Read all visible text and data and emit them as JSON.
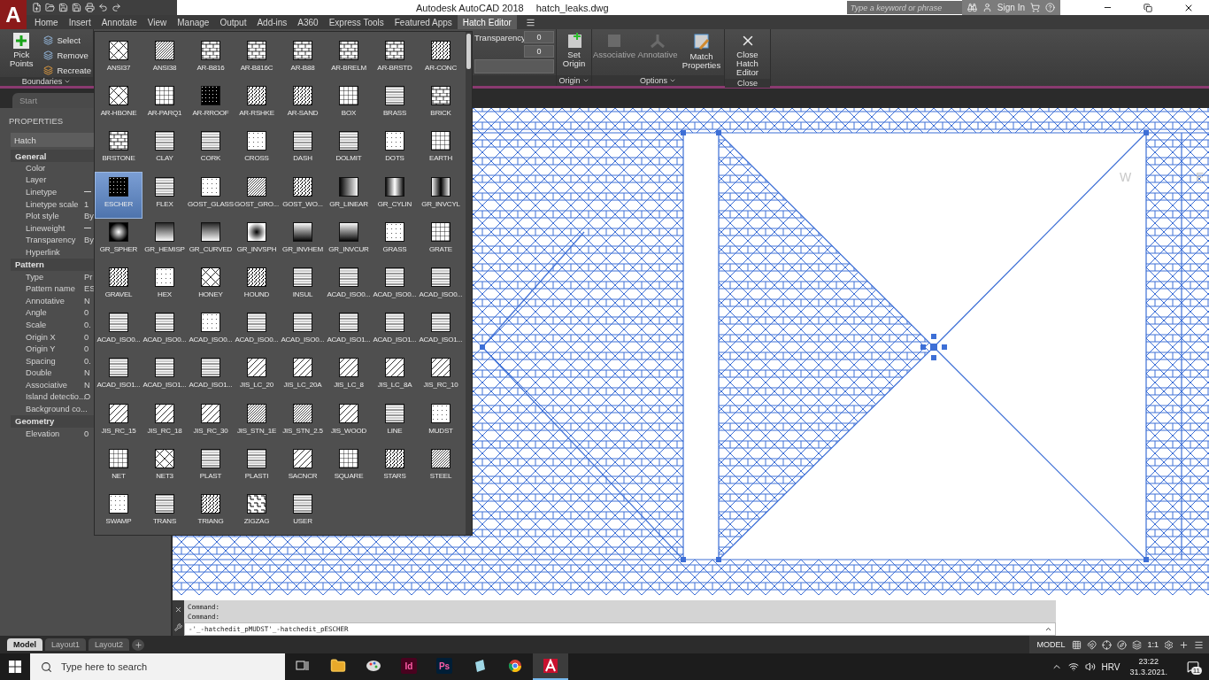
{
  "app_logo": "A",
  "title_bar": {
    "app_name": "Autodesk AutoCAD 2018",
    "file_name": "hatch_leaks.dwg",
    "search": {
      "placeholder": "Type a keyword or phrase"
    },
    "sign_in": "Sign In"
  },
  "ribbon_tabs": [
    {
      "label": "Home",
      "selected": false
    },
    {
      "label": "Insert",
      "selected": false
    },
    {
      "label": "Annotate",
      "selected": false
    },
    {
      "label": "View",
      "selected": false
    },
    {
      "label": "Manage",
      "selected": false
    },
    {
      "label": "Output",
      "selected": false
    },
    {
      "label": "Add-ins",
      "selected": false
    },
    {
      "label": "A360",
      "selected": false
    },
    {
      "label": "Express Tools",
      "selected": false
    },
    {
      "label": "Featured Apps",
      "selected": false
    },
    {
      "label": "Hatch Editor",
      "selected": true
    }
  ],
  "ribbon": {
    "boundaries": {
      "pick_points": "Pick Points",
      "select": "Select",
      "remove": "Remove",
      "recreate": "Recreate",
      "footer": "Boundaries"
    },
    "properties": {
      "transparency_label": "Transparency",
      "transparency_value": "0",
      "second_value": "0"
    },
    "origin": {
      "set_origin": "Set Origin",
      "footer": "Origin"
    },
    "options": {
      "buttons": [
        {
          "label": "Associative",
          "disabled": true
        },
        {
          "label": "Annotative",
          "disabled": true
        }
      ],
      "match_properties": "Match Properties",
      "footer": "Options"
    },
    "close": {
      "button": "Close Hatch Editor",
      "footer": "Close"
    }
  },
  "file_tabs": [
    {
      "label": "Start"
    }
  ],
  "properties_palette": {
    "title": "PROPERTIES",
    "selector": "Hatch",
    "sections": [
      {
        "title": "General",
        "rows": [
          {
            "label": "Color"
          },
          {
            "label": "Layer"
          },
          {
            "label": "Linetype",
            "line_sample": true
          },
          {
            "label": "Linetype scale",
            "value": "1"
          },
          {
            "label": "Plot style",
            "value": "By"
          },
          {
            "label": "Lineweight",
            "line_sample": true
          },
          {
            "label": "Transparency",
            "value": "By"
          },
          {
            "label": "Hyperlink"
          }
        ]
      },
      {
        "title": "Pattern",
        "rows": [
          {
            "label": "Type",
            "value": "Pr"
          },
          {
            "label": "Pattern name",
            "value": "ES"
          },
          {
            "label": "Annotative",
            "value": "N"
          },
          {
            "label": "Angle",
            "value": "0"
          },
          {
            "label": "Scale",
            "value": "0."
          },
          {
            "label": "Origin X",
            "value": "0"
          },
          {
            "label": "Origin Y",
            "value": "0"
          },
          {
            "label": "Spacing",
            "value": "0."
          },
          {
            "label": "Double",
            "value": "N"
          },
          {
            "label": "Associative",
            "value": "N"
          },
          {
            "label": "Island detectio...",
            "value": "O"
          },
          {
            "label": "Background co..."
          }
        ]
      },
      {
        "title": "Geometry",
        "rows": [
          {
            "label": "Elevation",
            "value": "0"
          }
        ]
      }
    ]
  },
  "pattern_gallery": {
    "items": [
      {
        "name": "ANSI37",
        "kind": "cross",
        "selected": false
      },
      {
        "name": "ANSI38",
        "kind": "diag-dense",
        "selected": false
      },
      {
        "name": "AR-B816",
        "kind": "brick",
        "selected": false
      },
      {
        "name": "AR-B816C",
        "kind": "brick",
        "selected": false
      },
      {
        "name": "AR-B88",
        "kind": "brick",
        "selected": false
      },
      {
        "name": "AR-BRELM",
        "kind": "brick",
        "selected": false
      },
      {
        "name": "AR-BRSTD",
        "kind": "brick",
        "selected": false
      },
      {
        "name": "AR-CONC",
        "kind": "noise",
        "selected": false
      },
      {
        "name": "AR-HBONE",
        "kind": "cross",
        "selected": false
      },
      {
        "name": "AR-PARQ1",
        "kind": "grid",
        "selected": false
      },
      {
        "name": "AR-RROOF",
        "kind": "dark",
        "selected": false
      },
      {
        "name": "AR-RSHKE",
        "kind": "noise",
        "selected": false
      },
      {
        "name": "AR-SAND",
        "kind": "noise",
        "selected": false
      },
      {
        "name": "BOX",
        "kind": "grid",
        "selected": false
      },
      {
        "name": "BRASS",
        "kind": "lines",
        "selected": false
      },
      {
        "name": "BRICK",
        "kind": "brick",
        "selected": false
      },
      {
        "name": "BRSTONE",
        "kind": "brick",
        "selected": false
      },
      {
        "name": "CLAY",
        "kind": "lines",
        "selected": false
      },
      {
        "name": "CORK",
        "kind": "lines",
        "selected": false
      },
      {
        "name": "CROSS",
        "kind": "dots",
        "selected": false
      },
      {
        "name": "DASH",
        "kind": "lines",
        "selected": false
      },
      {
        "name": "DOLMIT",
        "kind": "lines",
        "selected": false
      },
      {
        "name": "DOTS",
        "kind": "dots",
        "selected": false
      },
      {
        "name": "EARTH",
        "kind": "grid",
        "selected": false
      },
      {
        "name": "ESCHER",
        "kind": "dark",
        "selected": true
      },
      {
        "name": "FLEX",
        "kind": "lines",
        "selected": false
      },
      {
        "name": "GOST_GLASS",
        "kind": "dots",
        "selected": false
      },
      {
        "name": "GOST_GRO...",
        "kind": "diag-dense",
        "selected": false
      },
      {
        "name": "GOST_WO...",
        "kind": "noise",
        "selected": false
      },
      {
        "name": "GR_LINEAR",
        "kind": "grad-linear",
        "selected": false
      },
      {
        "name": "GR_CYLIN",
        "kind": "grad-cyl",
        "selected": false
      },
      {
        "name": "GR_INVCYL",
        "kind": "grad-invcyl",
        "selected": false
      },
      {
        "name": "GR_SPHER",
        "kind": "grad-sphere",
        "selected": false
      },
      {
        "name": "GR_HEMISP",
        "kind": "grad-hemi",
        "selected": false
      },
      {
        "name": "GR_CURVED",
        "kind": "grad-hemi",
        "selected": false
      },
      {
        "name": "GR_INVSPH",
        "kind": "grad-invsph",
        "selected": false
      },
      {
        "name": "GR_INVHEM",
        "kind": "grad-invhem",
        "selected": false
      },
      {
        "name": "GR_INVCUR",
        "kind": "grad-invhem",
        "selected": false
      },
      {
        "name": "GRASS",
        "kind": "dots",
        "selected": false
      },
      {
        "name": "GRATE",
        "kind": "grid",
        "selected": false
      },
      {
        "name": "GRAVEL",
        "kind": "noise",
        "selected": false
      },
      {
        "name": "HEX",
        "kind": "dots",
        "selected": false
      },
      {
        "name": "HONEY",
        "kind": "cross",
        "selected": false
      },
      {
        "name": "HOUND",
        "kind": "noise",
        "selected": false
      },
      {
        "name": "INSUL",
        "kind": "lines",
        "selected": false
      },
      {
        "name": "ACAD_ISO0...",
        "kind": "lines",
        "selected": false
      },
      {
        "name": "ACAD_ISO0...",
        "kind": "lines",
        "selected": false
      },
      {
        "name": "ACAD_ISO0...",
        "kind": "lines",
        "selected": false
      },
      {
        "name": "ACAD_ISO0...",
        "kind": "lines",
        "selected": false
      },
      {
        "name": "ACAD_ISO0...",
        "kind": "lines",
        "selected": false
      },
      {
        "name": "ACAD_ISO0...",
        "kind": "dots",
        "selected": false
      },
      {
        "name": "ACAD_ISO0...",
        "kind": "lines",
        "selected": false
      },
      {
        "name": "ACAD_ISO0...",
        "kind": "lines",
        "selected": false
      },
      {
        "name": "ACAD_ISO1...",
        "kind": "lines",
        "selected": false
      },
      {
        "name": "ACAD_ISO1...",
        "kind": "lines",
        "selected": false
      },
      {
        "name": "ACAD_ISO1...",
        "kind": "lines",
        "selected": false
      },
      {
        "name": "ACAD_ISO1...",
        "kind": "lines",
        "selected": false
      },
      {
        "name": "ACAD_ISO1...",
        "kind": "lines",
        "selected": false
      },
      {
        "name": "ACAD_ISO1...",
        "kind": "lines",
        "selected": false
      },
      {
        "name": "JIS_LC_20",
        "kind": "diag",
        "selected": false
      },
      {
        "name": "JIS_LC_20A",
        "kind": "diag",
        "selected": false
      },
      {
        "name": "JIS_LC_8",
        "kind": "diag",
        "selected": false
      },
      {
        "name": "JIS_LC_8A",
        "kind": "diag",
        "selected": false
      },
      {
        "name": "JIS_RC_10",
        "kind": "diag",
        "selected": false
      },
      {
        "name": "JIS_RC_15",
        "kind": "diag",
        "selected": false
      },
      {
        "name": "JIS_RC_18",
        "kind": "diag",
        "selected": false
      },
      {
        "name": "JIS_RC_30",
        "kind": "diag",
        "selected": false
      },
      {
        "name": "JIS_STN_1E",
        "kind": "diag-dense",
        "selected": false
      },
      {
        "name": "JIS_STN_2.5",
        "kind": "diag-dense",
        "selected": false
      },
      {
        "name": "JIS_WOOD",
        "kind": "diag",
        "selected": false
      },
      {
        "name": "LINE",
        "kind": "lines",
        "selected": false
      },
      {
        "name": "MUDST",
        "kind": "dots",
        "selected": false
      },
      {
        "name": "NET",
        "kind": "grid",
        "selected": false
      },
      {
        "name": "NET3",
        "kind": "cross",
        "selected": false
      },
      {
        "name": "PLAST",
        "kind": "lines",
        "selected": false
      },
      {
        "name": "PLASTI",
        "kind": "lines",
        "selected": false
      },
      {
        "name": "SACNCR",
        "kind": "diag",
        "selected": false
      },
      {
        "name": "SQUARE",
        "kind": "grid",
        "selected": false
      },
      {
        "name": "STARS",
        "kind": "noise",
        "selected": false
      },
      {
        "name": "STEEL",
        "kind": "diag-dense",
        "selected": false
      },
      {
        "name": "SWAMP",
        "kind": "dots",
        "selected": false
      },
      {
        "name": "TRANS",
        "kind": "lines",
        "selected": false
      },
      {
        "name": "TRIANG",
        "kind": "noise",
        "selected": false
      },
      {
        "name": "ZIGZAG",
        "kind": "zigzag",
        "selected": false
      },
      {
        "name": "USER",
        "kind": "lines",
        "selected": false
      }
    ]
  },
  "canvas": {
    "compass": [
      "W",
      "E"
    ]
  },
  "command_line": {
    "history": [
      "Command:",
      "Command:"
    ],
    "input": "-'_-hatchedit_pMUDST'_-hatchedit_pESCHER"
  },
  "layout_tabs": [
    {
      "label": "Model",
      "selected": true
    },
    {
      "label": "Layout1",
      "selected": false
    },
    {
      "label": "Layout2",
      "selected": false
    }
  ],
  "status_bar": {
    "space": "MODEL",
    "scale": "1:1"
  },
  "taskbar": {
    "search_placeholder": "Type here to search",
    "apps": [
      {
        "kind": "taskview",
        "selected": false
      },
      {
        "kind": "folder",
        "selected": false
      },
      {
        "kind": "paint",
        "selected": false
      },
      {
        "kind": "letter",
        "label": "Id",
        "color": "#49021f",
        "selected": false
      },
      {
        "kind": "letter",
        "label": "Ps",
        "color": "#001e36",
        "selected": false
      },
      {
        "kind": "notebook",
        "selected": false
      },
      {
        "kind": "browser",
        "selected": false
      },
      {
        "kind": "autocad",
        "selected": true
      }
    ],
    "language": "HRV",
    "time": "23:22",
    "date": "31.3.2021.",
    "notifications": "11"
  }
}
